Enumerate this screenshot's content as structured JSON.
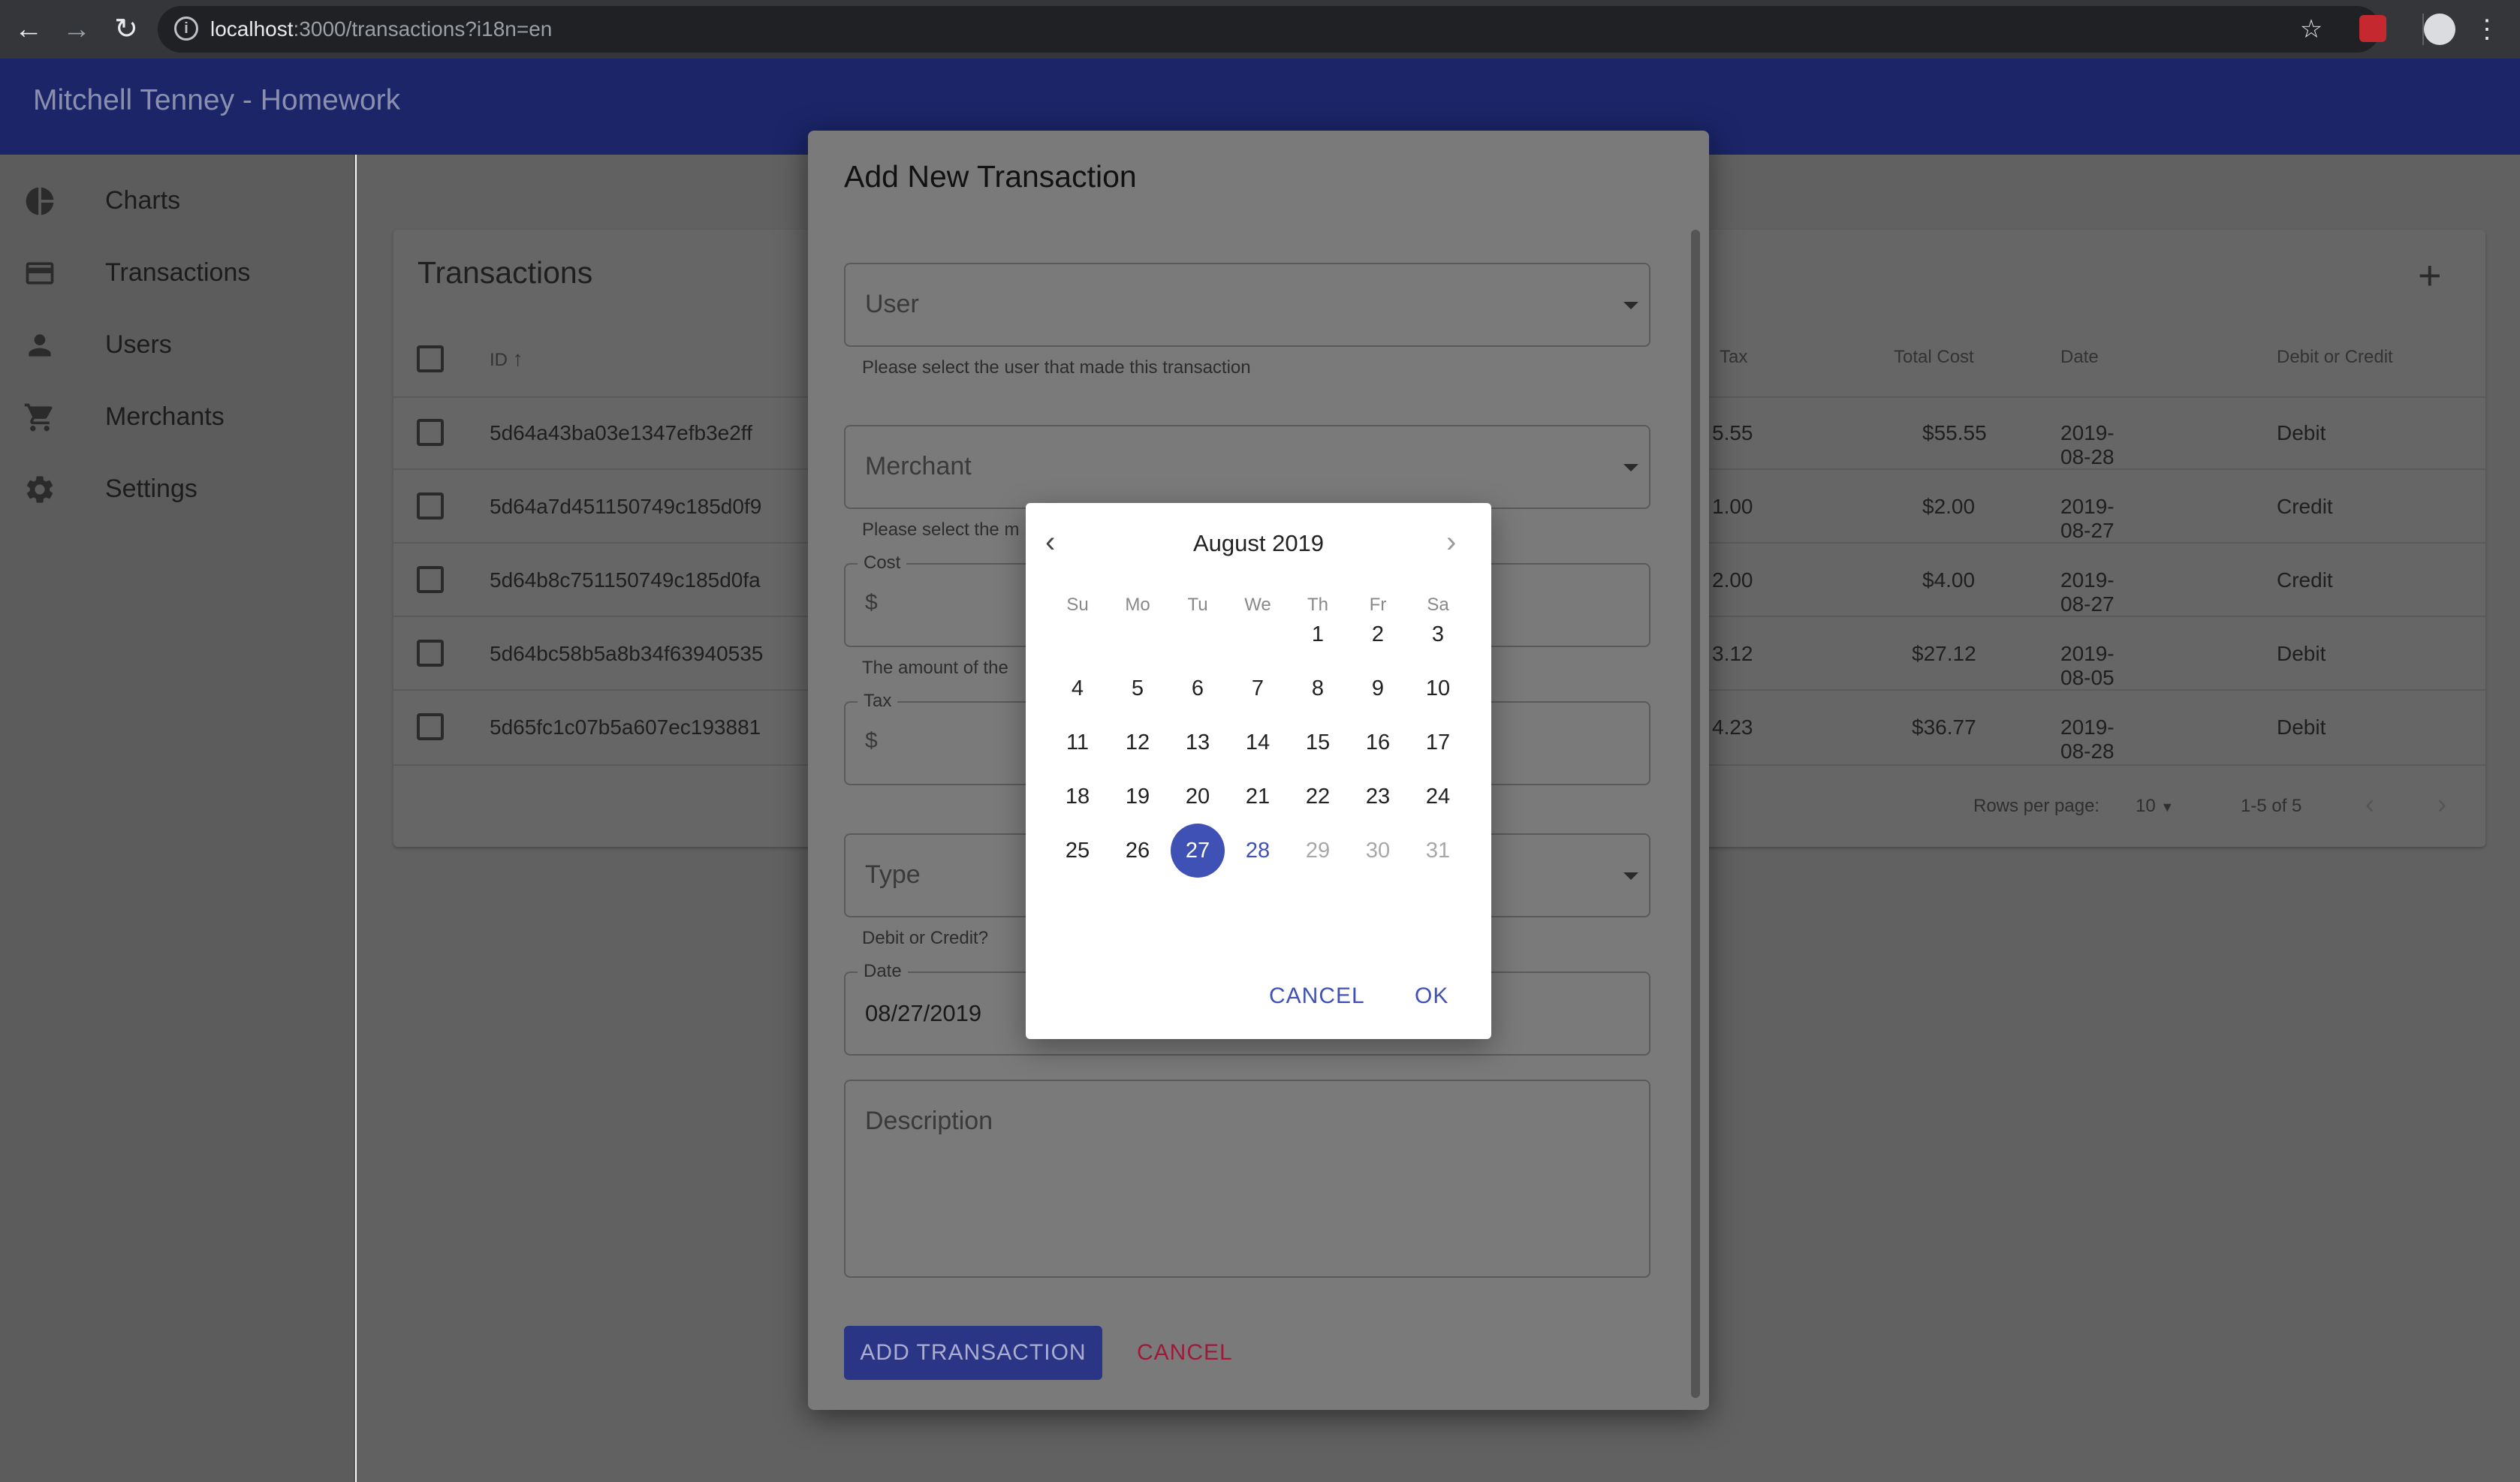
{
  "browser": {
    "url_host": "localhost",
    "url_rest": ":3000/transactions?i18n=en"
  },
  "app": {
    "title": "Mitchell Tenney - Homework"
  },
  "sidebar": {
    "items": [
      {
        "label": "Charts",
        "icon": "pie-chart-icon"
      },
      {
        "label": "Transactions",
        "icon": "credit-card-icon"
      },
      {
        "label": "Users",
        "icon": "person-icon"
      },
      {
        "label": "Merchants",
        "icon": "cart-icon"
      },
      {
        "label": "Settings",
        "icon": "gear-icon"
      }
    ]
  },
  "table": {
    "title": "Transactions",
    "headers": {
      "id": "ID",
      "tax": "Tax",
      "total": "Total Cost",
      "date": "Date",
      "type": "Debit or Credit"
    },
    "rows": [
      {
        "id": "5d64a43ba03e1347efb3e2ff",
        "tax": "5.55",
        "total": "$55.55",
        "date": "2019-08-28",
        "type": "Debit"
      },
      {
        "id": "5d64a7d451150749c185d0f9",
        "tax": "1.00",
        "total": "$2.00",
        "date": "2019-08-27",
        "type": "Credit"
      },
      {
        "id": "5d64b8c751150749c185d0fa",
        "tax": "2.00",
        "total": "$4.00",
        "date": "2019-08-27",
        "type": "Credit"
      },
      {
        "id": "5d64bc58b5a8b34f63940535",
        "tax": "3.12",
        "total": "$27.12",
        "date": "2019-08-05",
        "type": "Debit"
      },
      {
        "id": "5d65fc1c07b5a607ec193881",
        "tax": "4.23",
        "total": "$36.77",
        "date": "2019-08-28",
        "type": "Debit"
      }
    ],
    "footer": {
      "rows_per_page_label": "Rows per page:",
      "rows_per_page": "10",
      "range": "1-5 of 5"
    }
  },
  "dialog": {
    "title": "Add New Transaction",
    "user": {
      "label": "User",
      "helper": "Please select the user that made this transaction"
    },
    "merchant": {
      "label": "Merchant",
      "helper": "Please select the m"
    },
    "cost": {
      "legend": "Cost",
      "prefix": "$",
      "helper": "The amount of the "
    },
    "tax": {
      "legend": "Tax",
      "prefix": "$"
    },
    "type": {
      "label": "Type",
      "helper": "Debit or Credit?"
    },
    "date": {
      "legend": "Date",
      "value": "08/27/2019"
    },
    "description": {
      "label": "Description"
    },
    "submit_label": "ADD TRANSACTION",
    "cancel_label": "CANCEL"
  },
  "datepicker": {
    "month": "August 2019",
    "weekdays": [
      "Su",
      "Mo",
      "Tu",
      "We",
      "Th",
      "Fr",
      "Sa"
    ],
    "first_weekday_index": 4,
    "days_in_month": 31,
    "selected_day": 27,
    "today_day": 28,
    "disabled_after": 28,
    "cancel_label": "CANCEL",
    "ok_label": "OK",
    "colors": {
      "accent": "#3f51b5"
    }
  }
}
